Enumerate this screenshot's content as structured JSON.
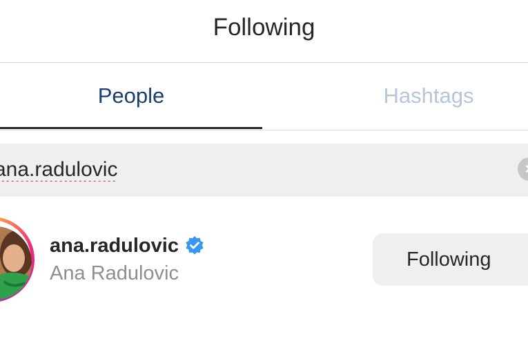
{
  "header": {
    "title": "Following"
  },
  "tabs": [
    {
      "label": "People",
      "active": true
    },
    {
      "label": "Hashtags",
      "active": false
    }
  ],
  "search": {
    "value": "ana.radulovic",
    "clear_icon": "clear-circle-icon"
  },
  "results": [
    {
      "username": "ana.radulovic",
      "verified": true,
      "full_name": "Ana Radulovic",
      "button_label": "Following"
    }
  ],
  "colors": {
    "active_tab": "#1b3d6e",
    "inactive_tab": "#b4c6da",
    "verified_badge": "#3897f0",
    "button_bg": "#efefef",
    "search_bg": "#efefef",
    "secondary_text": "#8e8e8e"
  }
}
